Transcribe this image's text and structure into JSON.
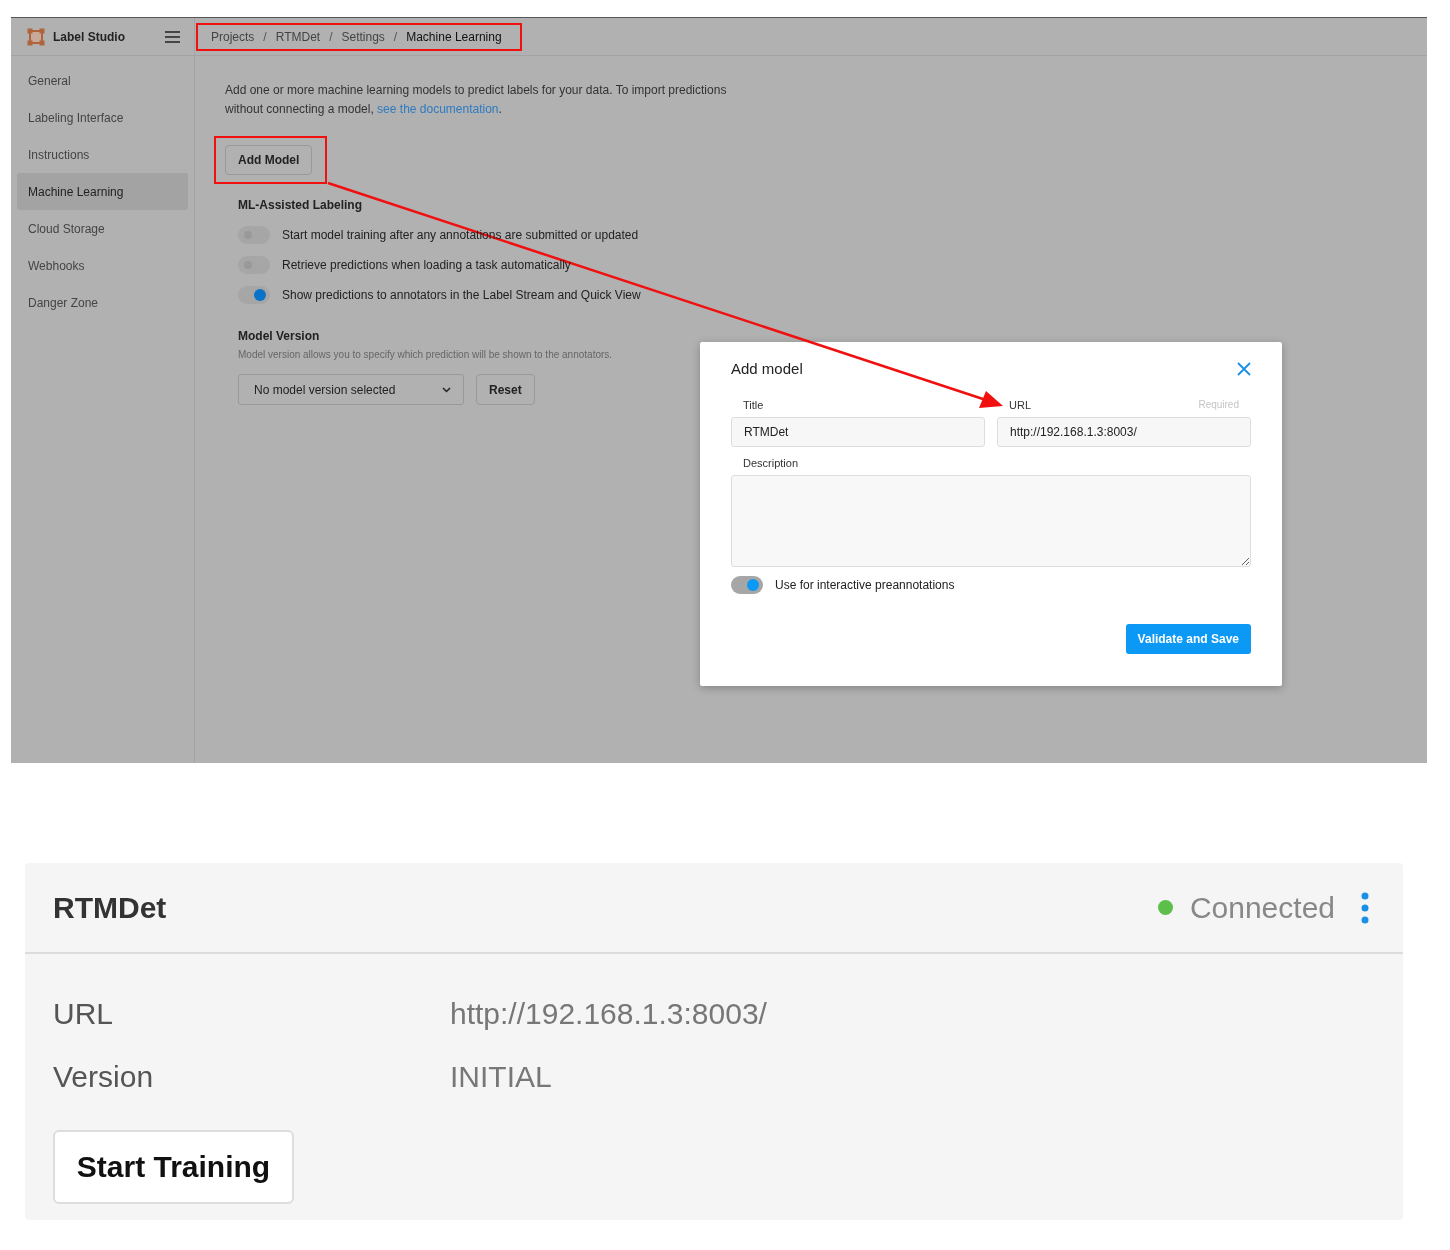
{
  "app": {
    "name": "Label Studio"
  },
  "breadcrumbs": [
    {
      "label": "Projects",
      "current": false
    },
    {
      "label": "RTMDet",
      "current": false
    },
    {
      "label": "Settings",
      "current": false
    },
    {
      "label": "Machine Learning",
      "current": true
    }
  ],
  "breadcrumb_separator": "/",
  "sidebar": {
    "items": [
      {
        "label": "General",
        "selected": false
      },
      {
        "label": "Labeling Interface",
        "selected": false
      },
      {
        "label": "Instructions",
        "selected": false
      },
      {
        "label": "Machine Learning",
        "selected": true
      },
      {
        "label": "Cloud Storage",
        "selected": false
      },
      {
        "label": "Webhooks",
        "selected": false
      },
      {
        "label": "Danger Zone",
        "selected": false
      }
    ]
  },
  "intro": {
    "text": "Add one or more machine learning models to predict labels for your data. To import predictions without connecting a model,",
    "link": "see the documentation",
    "after": "."
  },
  "add_model_button": "Add Model",
  "ml_assisted": {
    "title": "ML-Assisted Labeling",
    "toggles": [
      {
        "label": "Start model training after any annotations are submitted or updated",
        "on": false
      },
      {
        "label": "Retrieve predictions when loading a task automatically",
        "on": false
      },
      {
        "label": "Show predictions to annotators in the Label Stream and Quick View",
        "on": true
      }
    ]
  },
  "model_version": {
    "title": "Model Version",
    "help": "Model version allows you to specify which prediction will be shown to the annotators.",
    "select_value": "No model version selected",
    "reset_button": "Reset"
  },
  "modal": {
    "title": "Add model",
    "fields": [
      {
        "label": "Title",
        "value": "RTMDet"
      },
      {
        "label": "URL",
        "hint": "Required",
        "value": "http://192.168.1.3:8003/"
      }
    ],
    "description_label": "Description",
    "interactive": {
      "label": "Use for interactive preannotations",
      "on": true
    },
    "submit_button": "Validate and Save"
  },
  "model_card": {
    "title": "RTMDet",
    "status": {
      "label": "Connected",
      "color": "#5bbf4a"
    },
    "rows": [
      {
        "label": "URL",
        "value": "http://192.168.1.3:8003/"
      },
      {
        "label": "Version",
        "value": "INITIAL"
      }
    ],
    "train_button": "Start Training"
  }
}
